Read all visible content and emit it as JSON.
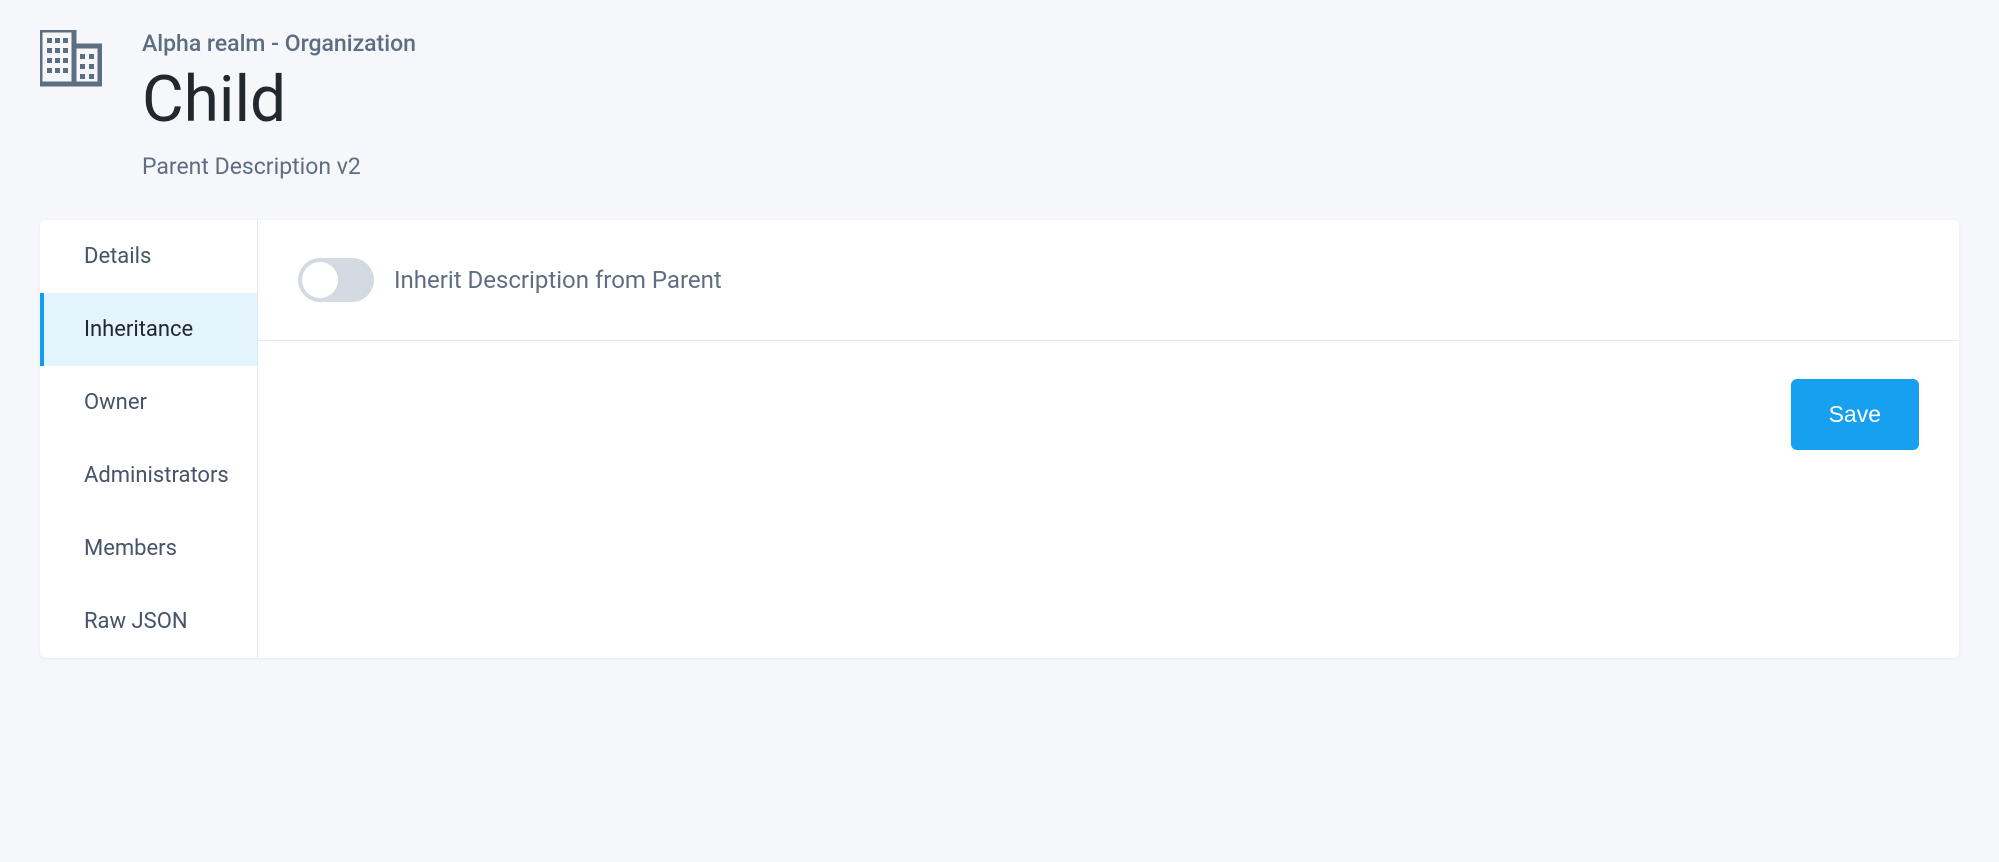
{
  "header": {
    "breadcrumb": "Alpha realm - Organization",
    "title": "Child",
    "description": "Parent Description v2",
    "icon": "organization-building-icon"
  },
  "sidebar": {
    "items": [
      {
        "label": "Details",
        "active": false
      },
      {
        "label": "Inheritance",
        "active": true
      },
      {
        "label": "Owner",
        "active": false
      },
      {
        "label": "Administrators",
        "active": false
      },
      {
        "label": "Members",
        "active": false
      },
      {
        "label": "Raw JSON",
        "active": false
      }
    ]
  },
  "main": {
    "toggle": {
      "label": "Inherit Description from Parent",
      "state": "off"
    },
    "actions": {
      "save_label": "Save"
    }
  },
  "colors": {
    "accent": "#179ff0",
    "background": "#f5f7fa",
    "active_tab_bg": "#e4f4fd",
    "toggle_off_bg": "#d3dae1"
  }
}
